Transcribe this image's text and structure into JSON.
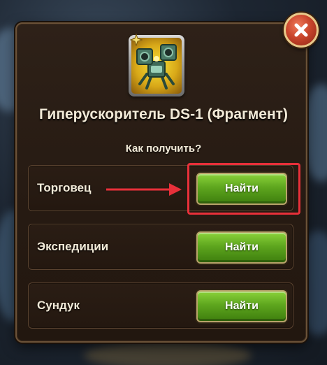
{
  "dialog": {
    "item_title": "Гиперускоритель DS-1 (Фрагмент)",
    "how_to_get": "Как получить?",
    "item_icon": "robot-fragment-icon",
    "close_icon": "close-x-icon"
  },
  "sources": [
    {
      "label": "Торговец",
      "button": "Найти",
      "highlighted": true
    },
    {
      "label": "Экспедиции",
      "button": "Найти",
      "highlighted": false
    },
    {
      "label": "Сундук",
      "button": "Найти",
      "highlighted": false
    }
  ],
  "colors": {
    "button_green": "#5ea61e",
    "highlight_red": "#e8303a",
    "panel_brown": "#2e2118",
    "close_red": "#c9452c"
  }
}
